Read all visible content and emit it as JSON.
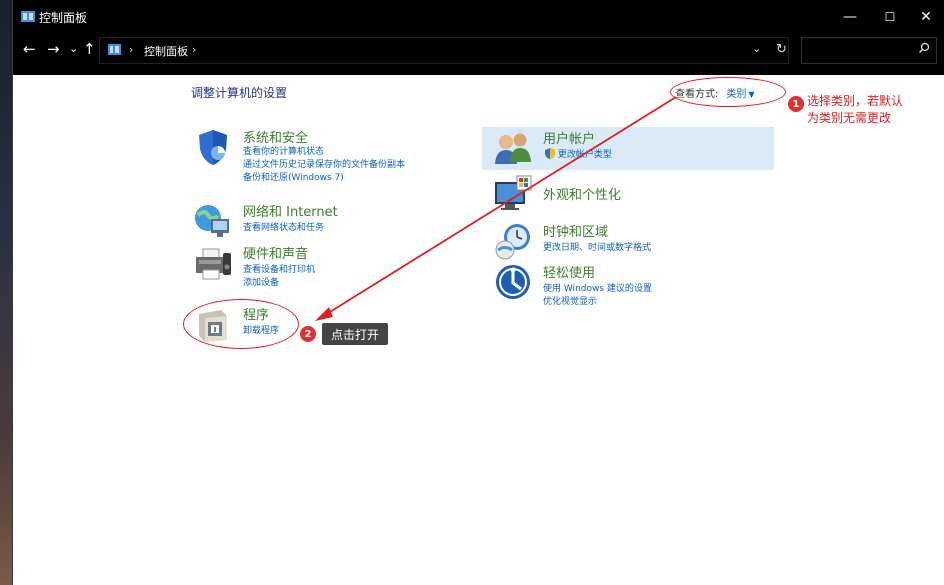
{
  "window": {
    "title": "控制面板"
  },
  "controls": {
    "minimize": "—",
    "maximize": "☐",
    "close": "✕"
  },
  "nav": {
    "back": "←",
    "forward": "→",
    "recent": "⌄",
    "up": "↑"
  },
  "address": {
    "separator": "›",
    "crumb": "控制面板",
    "crumb_after": "›"
  },
  "page": {
    "title": "调整计算机的设置",
    "view_by_label": "查看方式:",
    "view_by_value": "类别"
  },
  "categories": {
    "system": {
      "heading": "系统和安全",
      "links": [
        "查看你的计算机状态",
        "通过文件历史记录保存你的文件备份副本",
        "备份和还原(Windows 7)"
      ]
    },
    "network": {
      "heading": "网络和 Internet",
      "links": [
        "查看网络状态和任务"
      ]
    },
    "hardware": {
      "heading": "硬件和声音",
      "links": [
        "查看设备和打印机",
        "添加设备"
      ]
    },
    "programs": {
      "heading": "程序",
      "links": [
        "卸载程序"
      ]
    },
    "user": {
      "heading": "用户帐户",
      "links": [
        "更改帐户类型"
      ]
    },
    "appearance": {
      "heading": "外观和个性化",
      "links": []
    },
    "clock": {
      "heading": "时钟和区域",
      "links": [
        "更改日期、时间或数字格式"
      ]
    },
    "ease": {
      "heading": "轻松使用",
      "links": [
        "使用 Windows 建议的设置",
        "优化视觉显示"
      ]
    }
  },
  "annotations": {
    "badge1": "1",
    "note1_line1": "选择类别，若默认",
    "note1_line2": "为类别无需更改",
    "badge2": "2",
    "tooltip": "点击打开"
  },
  "colors": {
    "accent_link": "#0b5fc6",
    "heading_green": "#3b7d2b",
    "annotation_red": "#e02020",
    "titlebar": "#000000"
  },
  "icons": [
    "control-panel-icon",
    "back-icon",
    "forward-icon",
    "up-icon",
    "refresh-icon",
    "search-icon",
    "shield-icon",
    "globe-network-icon",
    "printer-icon",
    "program-box-icon",
    "users-icon",
    "monitor-palette-icon",
    "clock-globe-icon",
    "ease-of-access-icon"
  ]
}
